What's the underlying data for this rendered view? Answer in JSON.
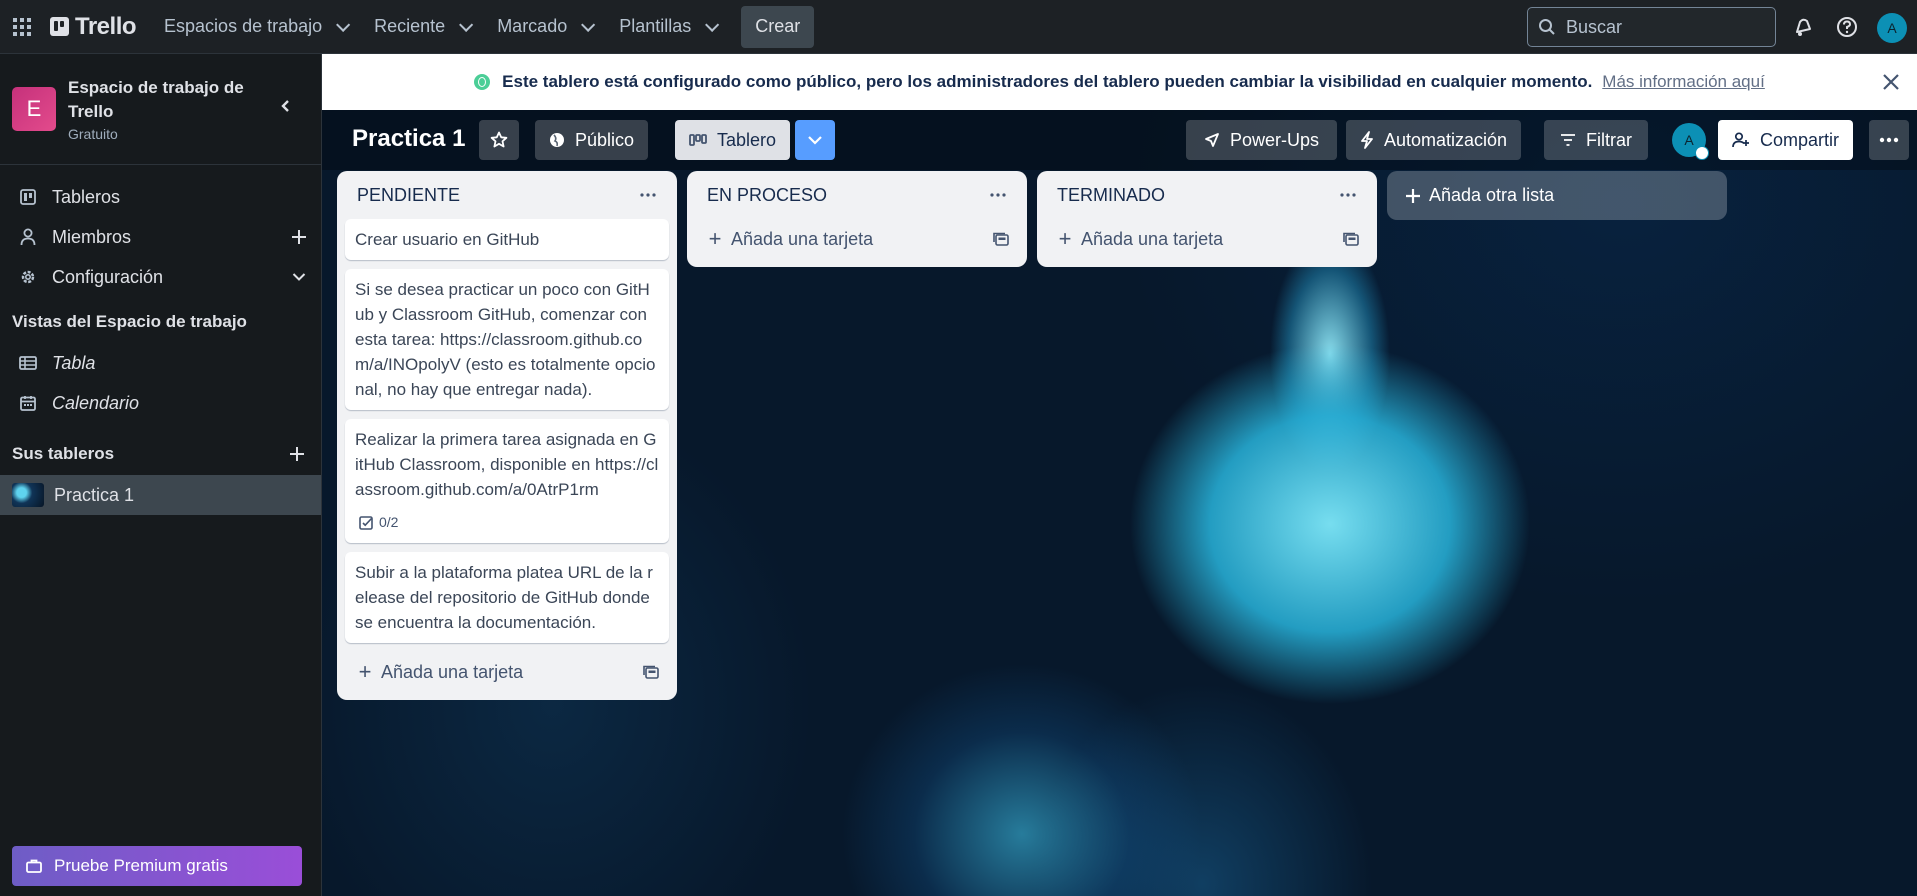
{
  "topbar": {
    "logo": "Trello",
    "nav": [
      {
        "label": "Espacios de trabajo"
      },
      {
        "label": "Reciente"
      },
      {
        "label": "Marcado"
      },
      {
        "label": "Plantillas"
      }
    ],
    "create_label": "Crear",
    "search_placeholder": "Buscar",
    "avatar_initial": "A"
  },
  "sidebar": {
    "workspace_badge": "E",
    "workspace_name": "Espacio de trabajo de Trello",
    "workspace_plan": "Gratuito",
    "items": [
      {
        "label": "Tableros"
      },
      {
        "label": "Miembros"
      },
      {
        "label": "Configuración"
      }
    ],
    "views_title": "Vistas del Espacio de trabajo",
    "views": [
      {
        "label": "Tabla"
      },
      {
        "label": "Calendario"
      }
    ],
    "boards_title": "Sus tableros",
    "boards": [
      {
        "label": "Practica 1"
      }
    ],
    "premium_label": "Pruebe Premium gratis"
  },
  "banner": {
    "message": "Este tablero está configurado como público, pero los administradores del tablero pueden cambiar la visibilidad en cualquier momento.",
    "link": "Más información aquí"
  },
  "board": {
    "title": "Practica 1",
    "visibility_label": "Público",
    "view_label": "Tablero",
    "powerups_label": "Power-Ups",
    "automation_label": "Automatización",
    "filter_label": "Filtrar",
    "member_initial": "A",
    "share_label": "Compartir",
    "add_list_label": "Añada otra lista",
    "lists": [
      {
        "title": "PENDIENTE",
        "cards": [
          {
            "text": "Crear usuario en GitHub"
          },
          {
            "text": "Si se desea practicar un poco con GitHub y Classroom GitHub, comenzar con esta tarea: https://classroom.github.com/a/INOpolyV (esto es totalmente opcional, no hay que entregar nada)."
          },
          {
            "text": "Realizar la primera tarea asignada en GitHub Classroom, disponible en https://classroom.github.com/a/0AtrP1rm",
            "checklist": "0/2"
          },
          {
            "text": "Subir a la plataforma platea URL de la release del repositorio de GitHub donde se encuentra la documentación."
          }
        ],
        "add_card_label": "Añada una tarjeta"
      },
      {
        "title": "EN PROCESO",
        "cards": [],
        "add_card_label": "Añada una tarjeta"
      },
      {
        "title": "TERMINADO",
        "cards": [],
        "add_card_label": "Añada una tarjeta"
      }
    ]
  },
  "colors": {
    "topbar_bg": "#1d2125",
    "sidebar_bg": "#161a1d",
    "accent": "#0c90b5",
    "premium_gradient_start": "#6e5dc6",
    "premium_gradient_end": "#9a4ed8"
  }
}
